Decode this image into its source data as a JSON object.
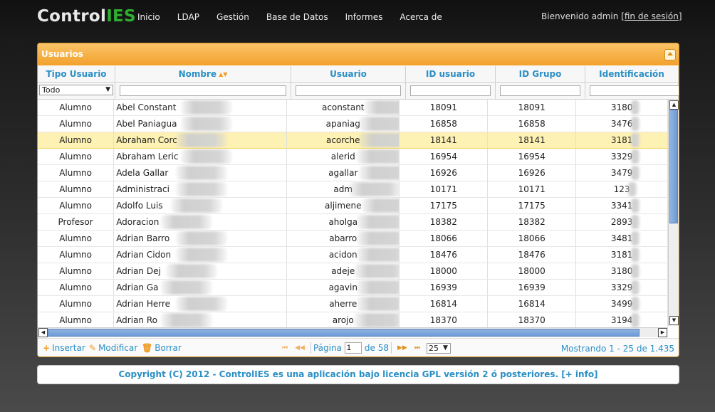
{
  "brand": {
    "part1": "Control",
    "part2": "IES"
  },
  "nav": [
    "Inicio",
    "LDAP",
    "Gestión",
    "Base de Datos",
    "Informes",
    "Acerca de"
  ],
  "welcome": {
    "text": "Bienvenido admin [",
    "logout": "fin de sesión",
    "close": "]"
  },
  "panel": {
    "title": "Usuarios"
  },
  "columns": [
    {
      "label": "Tipo Usuario",
      "width": 109
    },
    {
      "label": "Nombre",
      "width": 247,
      "sorted": true
    },
    {
      "label": "Usuario",
      "width": 161
    },
    {
      "label": "ID usuario",
      "width": 126
    },
    {
      "label": "ID Grupo",
      "width": 126
    },
    {
      "label": "Identificación",
      "width": 131
    }
  ],
  "filter": {
    "tipo_value": "Todo"
  },
  "rows": [
    {
      "tipo": "Alumno",
      "nombre": "Abel Constant",
      "usuario": "aconstant",
      "id_usuario": "18091",
      "id_grupo": "18091",
      "ident": "3180"
    },
    {
      "tipo": "Alumno",
      "nombre": "Abel Paniagua",
      "usuario": "apaniag",
      "id_usuario": "16858",
      "id_grupo": "16858",
      "ident": "3476"
    },
    {
      "tipo": "Alumno",
      "nombre": "Abraham Corc",
      "usuario": "acorche",
      "id_usuario": "18141",
      "id_grupo": "18141",
      "ident": "3181",
      "selected": true
    },
    {
      "tipo": "Alumno",
      "nombre": "Abraham Leric",
      "usuario": "alerid",
      "id_usuario": "16954",
      "id_grupo": "16954",
      "ident": "3329"
    },
    {
      "tipo": "Alumno",
      "nombre": "Adela Gallar",
      "usuario": "agallar",
      "id_usuario": "16926",
      "id_grupo": "16926",
      "ident": "3479"
    },
    {
      "tipo": "Alumno",
      "nombre": "Administraci",
      "usuario": "adm",
      "id_usuario": "10171",
      "id_grupo": "10171",
      "ident": "123"
    },
    {
      "tipo": "Alumno",
      "nombre": "Adolfo Luis",
      "usuario": "aljimene",
      "id_usuario": "17175",
      "id_grupo": "17175",
      "ident": "3341"
    },
    {
      "tipo": "Profesor",
      "nombre": "Adoracion",
      "usuario": "aholga",
      "id_usuario": "18382",
      "id_grupo": "18382",
      "ident": "2893"
    },
    {
      "tipo": "Alumno",
      "nombre": "Adrian Barro",
      "usuario": "abarro",
      "id_usuario": "18066",
      "id_grupo": "18066",
      "ident": "3481"
    },
    {
      "tipo": "Alumno",
      "nombre": "Adrian Cidon",
      "usuario": "acidon",
      "id_usuario": "18476",
      "id_grupo": "18476",
      "ident": "3181"
    },
    {
      "tipo": "Alumno",
      "nombre": "Adrian Dej",
      "usuario": "adeje",
      "id_usuario": "18000",
      "id_grupo": "18000",
      "ident": "3180"
    },
    {
      "tipo": "Alumno",
      "nombre": "Adrian Ga",
      "usuario": "agavin",
      "id_usuario": "16939",
      "id_grupo": "16939",
      "ident": "3329"
    },
    {
      "tipo": "Alumno",
      "nombre": "Adrian Herre",
      "usuario": "aherre",
      "id_usuario": "16814",
      "id_grupo": "16814",
      "ident": "3499"
    },
    {
      "tipo": "Alumno",
      "nombre": "Adrian Ro",
      "usuario": "arojo",
      "id_usuario": "18370",
      "id_grupo": "18370",
      "ident": "3194"
    }
  ],
  "pager": {
    "insert": "Insertar",
    "edit": "Modificar",
    "delete": "Borrar",
    "page_label": "Página",
    "page_value": "1",
    "of_label": "de 58",
    "page_size": "25",
    "showing": "Mostrando 1 - 25 de 1.435"
  },
  "footer": {
    "text": "Copyright (C) 2012 - ControlIES es una aplicación bajo licencia GPL versión 2 ó posteriores. ",
    "link": "[+ info]"
  },
  "icons": {
    "collapse": "collapse-up-icon",
    "sort": "sort-desc-icon",
    "insert": "plus-icon",
    "edit": "pencil-icon",
    "delete": "trash-icon"
  },
  "colors": {
    "accent": "#2a8fc5",
    "header_orange": "#f2a12c",
    "brand_green": "#2fae2f",
    "selected_row": "#fdf1b3"
  }
}
